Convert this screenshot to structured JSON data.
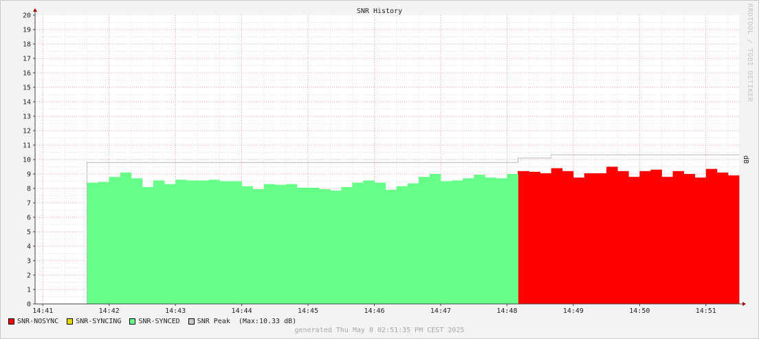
{
  "chart_data": {
    "type": "area",
    "title": "SNR History",
    "ylabel": "dB",
    "xlabel": "",
    "ylim": [
      0,
      20
    ],
    "xlim": [
      "14:40:53",
      "14:51:30"
    ],
    "grid": true,
    "legend_position": "bottom-left",
    "y_ticks": [
      0,
      1,
      2,
      3,
      4,
      5,
      6,
      7,
      8,
      9,
      10,
      11,
      12,
      13,
      14,
      15,
      16,
      17,
      18,
      19,
      20
    ],
    "x_ticks": [
      "14:41",
      "14:42",
      "14:43",
      "14:44",
      "14:45",
      "14:46",
      "14:47",
      "14:48",
      "14:49",
      "14:50",
      "14:51"
    ],
    "series": [
      {
        "name": "SNR-NOSYNC",
        "color": "#ff0000",
        "x_start": "14:48:10",
        "step_seconds": 10,
        "values": [
          9.2,
          9.15,
          9.05,
          9.4,
          9.2,
          8.75,
          9.05,
          9.05,
          9.5,
          9.2,
          8.8,
          9.2,
          9.3,
          8.8,
          9.2,
          9.0,
          8.75,
          9.35,
          9.1,
          8.9
        ]
      },
      {
        "name": "SNR-SYNCING",
        "color": "#e6d800",
        "values": []
      },
      {
        "name": "SNR-SYNCED",
        "color": "#66ff88",
        "x_start": "14:41:40",
        "step_seconds": 10,
        "values": [
          8.4,
          8.45,
          8.8,
          9.1,
          8.7,
          8.1,
          8.55,
          8.3,
          8.6,
          8.55,
          8.55,
          8.6,
          8.5,
          8.5,
          8.15,
          7.95,
          8.3,
          8.25,
          8.3,
          8.05,
          8.05,
          7.95,
          7.85,
          8.1,
          8.4,
          8.55,
          8.4,
          7.9,
          8.15,
          8.35,
          8.8,
          9.0,
          8.5,
          8.55,
          8.7,
          8.95,
          8.75,
          8.7,
          9.0
        ]
      },
      {
        "name": "SNR Peak",
        "color": "#c8c8c8",
        "type": "step",
        "points": [
          {
            "x": "14:41:40",
            "y": 9.8
          },
          {
            "x": "14:48:10",
            "y": 10.1
          },
          {
            "x": "14:48:40",
            "y": 10.33
          },
          {
            "x": "14:51:30",
            "y": 10.33
          }
        ]
      }
    ],
    "legend": [
      {
        "label": "SNR-NOSYNC",
        "color": "#ff0000"
      },
      {
        "label": "SNR-SYNCING",
        "color": "#e6d800"
      },
      {
        "label": "SNR-SYNCED",
        "color": "#66ff88"
      },
      {
        "label": "SNR Peak  (Max:10.33 dB)",
        "color": "#c8c8c8"
      }
    ]
  },
  "footer": {
    "generated": "generated Thu May  8 02:51:35 PM CEST 2025",
    "watermark": "RRDTOOL / TOBI OETIKER"
  }
}
